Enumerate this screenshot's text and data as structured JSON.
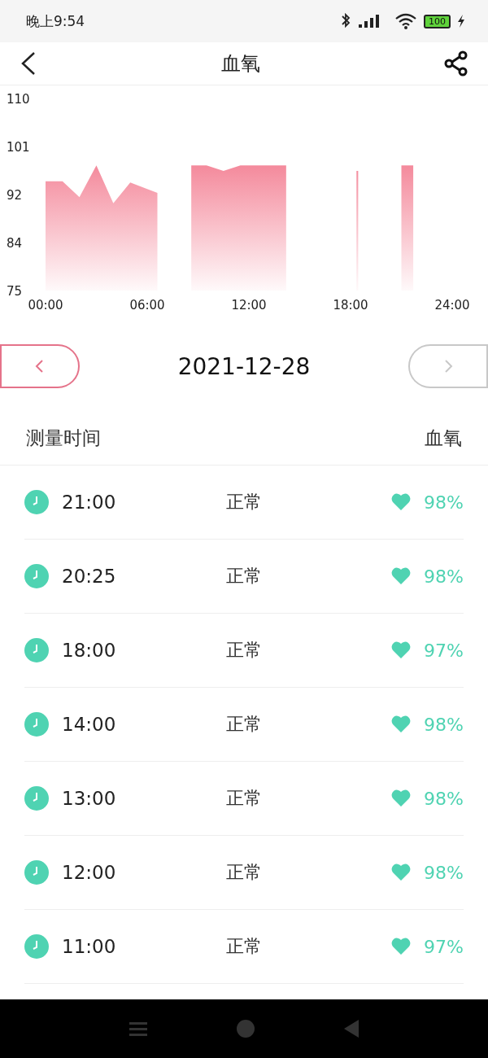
{
  "status_bar": {
    "time": "晚上9:54",
    "battery": "100"
  },
  "header": {
    "title": "血氧"
  },
  "chart_data": {
    "type": "area",
    "x": [
      0,
      1,
      2,
      3,
      4,
      5,
      6,
      6.6,
      8.6,
      9.5,
      10.5,
      11.5,
      13,
      14.2,
      18.35,
      18.45,
      21,
      21.7
    ],
    "series": [
      {
        "color": "#f48a9c",
        "values": [
          94.9,
          94.9,
          92,
          97.8,
          90.9,
          94.7,
          93.5,
          92.8,
          97.8,
          97.8,
          96.8,
          97.8,
          97.8,
          97.8,
          96.8,
          96.8,
          97.8,
          97.8
        ]
      }
    ],
    "xlim": [
      0,
      24
    ],
    "ylim": [
      75,
      110
    ],
    "xticks": [
      {
        "value": 0,
        "label": "00:00"
      },
      {
        "value": 6,
        "label": "06:00"
      },
      {
        "value": 12,
        "label": "12:00"
      },
      {
        "value": 18,
        "label": "18:00"
      },
      {
        "value": 24,
        "label": "24:00"
      }
    ],
    "yticks": [
      {
        "value": 75,
        "label": "75"
      },
      {
        "value": 83.75,
        "label": "84"
      },
      {
        "value": 92.5,
        "label": "92"
      },
      {
        "value": 101.25,
        "label": "101"
      },
      {
        "value": 110,
        "label": "110"
      }
    ]
  },
  "date_nav": {
    "date": "2021-12-28",
    "prev_disabled": false,
    "next_disabled": true
  },
  "list_header": {
    "column_1": "测量时间",
    "column_2": "血氧"
  },
  "records": [
    {
      "time": "21:00",
      "status": "正常",
      "value": "98%"
    },
    {
      "time": "20:25",
      "status": "正常",
      "value": "98%"
    },
    {
      "time": "18:00",
      "status": "正常",
      "value": "97%"
    },
    {
      "time": "14:00",
      "status": "正常",
      "value": "98%"
    },
    {
      "time": "13:00",
      "status": "正常",
      "value": "98%"
    },
    {
      "time": "12:00",
      "status": "正常",
      "value": "98%"
    },
    {
      "time": "11:00",
      "status": "正常",
      "value": "97%"
    }
  ]
}
